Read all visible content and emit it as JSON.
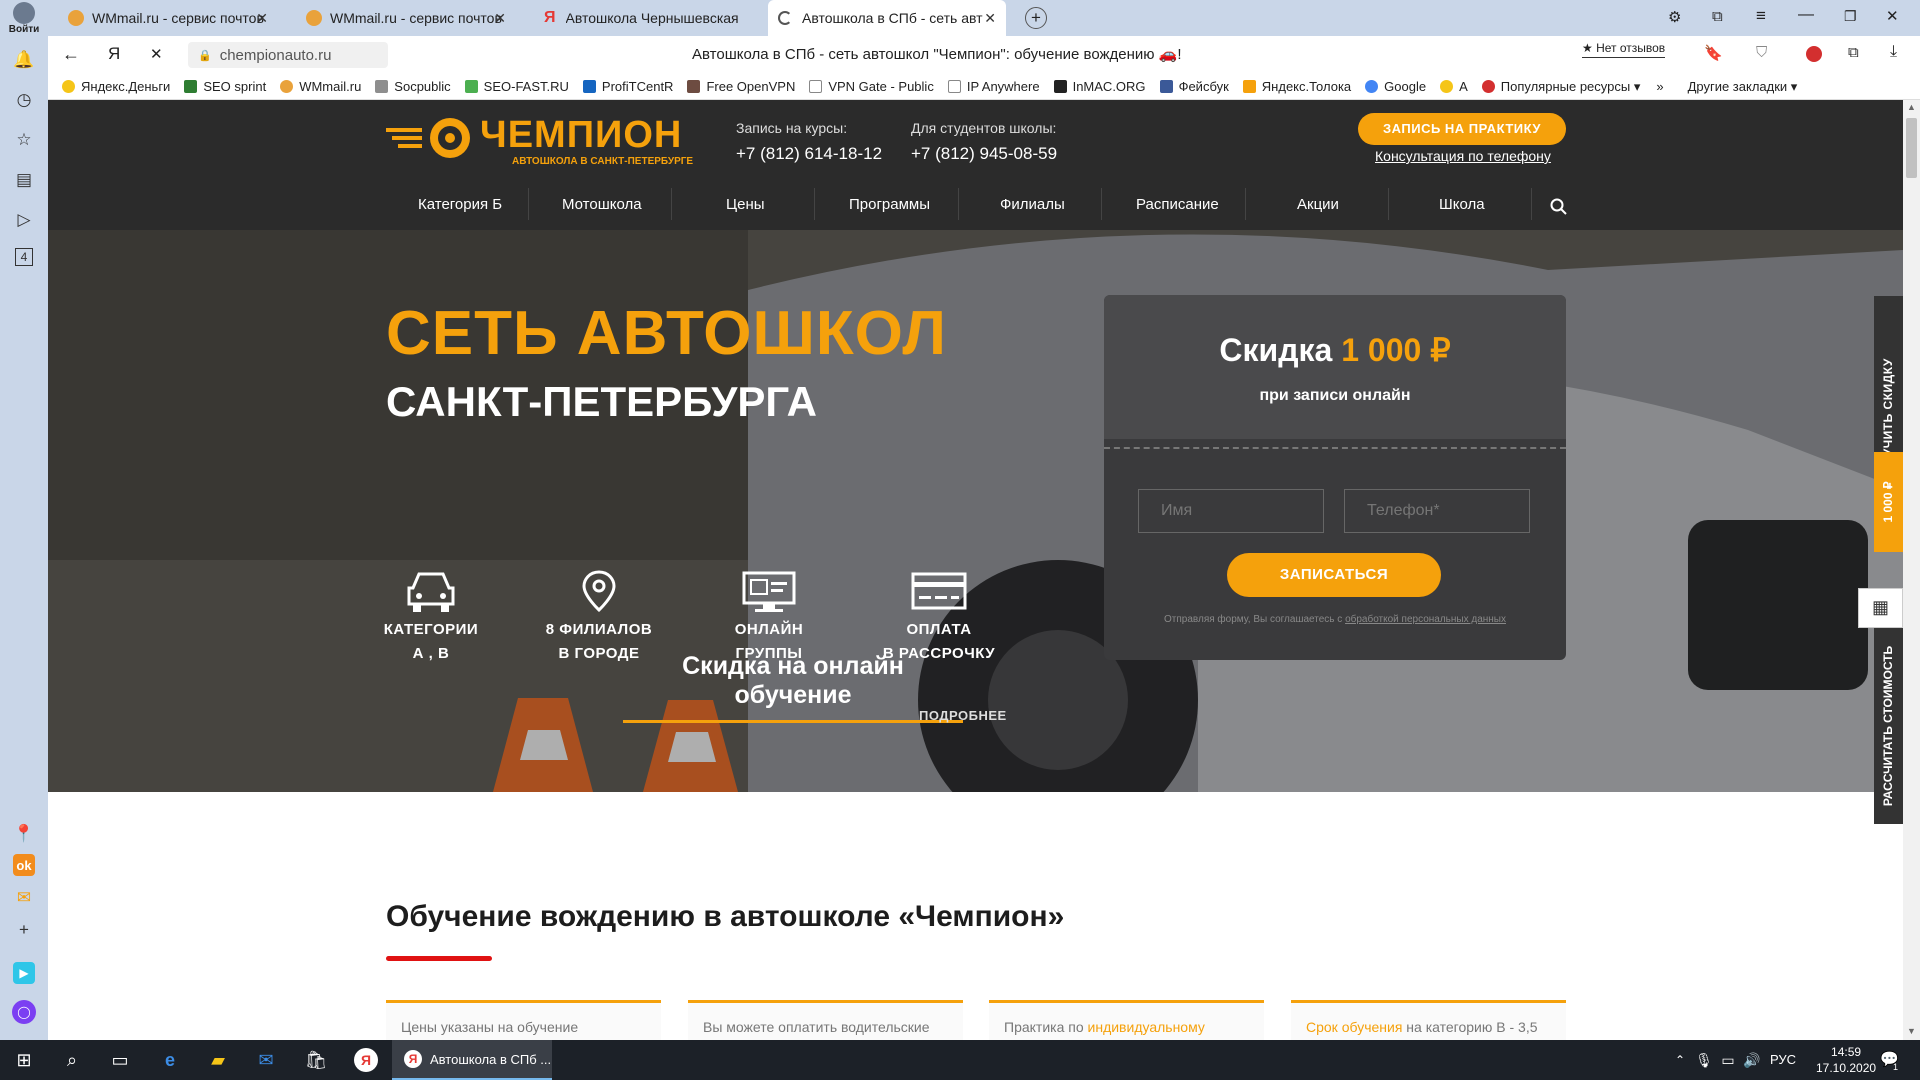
{
  "browser": {
    "tabs": [
      {
        "title": "WMmail.ru - сервис почтов",
        "color": "#e9a23b"
      },
      {
        "title": "WMmail.ru - сервис почтов",
        "color": "#e9a23b"
      },
      {
        "title": "Автошкола Чернышевская",
        "color": "#e53935"
      },
      {
        "title": "Автошкола в СПб - сеть авт",
        "color": "#555"
      }
    ],
    "login_label": "Войти",
    "url": "chempionauto.ru",
    "page_title": "Автошкола в СПб - сеть автошкол \"Чемпион\": обучение вождению 🚗!",
    "reviews_label": "★ Нет отзывов",
    "bookmarks": [
      {
        "label": "Яндекс.Деньги",
        "color": "#f5c518"
      },
      {
        "label": "SEO sprint",
        "color": "#2e7d32"
      },
      {
        "label": "WMmail.ru",
        "color": "#e9a23b"
      },
      {
        "label": "Socpublic",
        "color": "#8e8e8e"
      },
      {
        "label": "SEO-FAST.RU",
        "color": "#4caf50"
      },
      {
        "label": "ProfiTCentR",
        "color": "#1565c0"
      },
      {
        "label": "Free OpenVPN",
        "color": "#6d4c41"
      },
      {
        "label": "VPN Gate - Public",
        "color": "#9e9e9e"
      },
      {
        "label": "IP Anywhere",
        "color": "#9e9e9e"
      },
      {
        "label": "InMAC.ORG",
        "color": "#222"
      },
      {
        "label": "Фейсбук",
        "color": "#3b5998"
      },
      {
        "label": "Яндекс.Толока",
        "color": "#f5a10c"
      },
      {
        "label": "Google",
        "color": "#4285f4"
      },
      {
        "label": "A",
        "color": "#f5c518"
      },
      {
        "label": "Популярные ресурсы ▾",
        "color": "#d32f2f"
      }
    ],
    "other_bookmarks": "Другие закладки ▾"
  },
  "site": {
    "logo_name": "ЧЕМПИОН",
    "logo_sub": "АВТОШКОЛА В САНКТ-ПЕТЕРБУРГЕ",
    "contacts": [
      {
        "label": "Запись на курсы:",
        "phone": "+7 (812) 614-18-12"
      },
      {
        "label": "Для студентов школы:",
        "phone": "+7 (812) 945-08-59"
      }
    ],
    "cta_button": "ЗАПИСЬ НА ПРАКТИКУ",
    "consult_link": "Консультация по телефону",
    "nav": [
      "Категория Б",
      "Мотошкола",
      "Цены",
      "Программы",
      "Филиалы",
      "Расписание",
      "Акции",
      "Школа"
    ],
    "hero": {
      "title": "СЕТЬ АВТОШКОЛ",
      "subtitle": "САНКТ-ПЕТЕРБУРГА",
      "features": [
        {
          "line1": "КАТЕГОРИИ",
          "line2": "А , В",
          "icon": "car-icon"
        },
        {
          "line1": "8 ФИЛИАЛОВ",
          "line2": "В ГОРОДЕ",
          "icon": "map-pin-icon"
        },
        {
          "line1": "ОНЛАЙН",
          "line2": "ГРУППЫ",
          "icon": "monitor-icon"
        },
        {
          "line1": "ОПЛАТА",
          "line2": "В РАССРОЧКУ",
          "icon": "credit-card-icon"
        }
      ],
      "promo_link": "Скидка на онлайн обучение",
      "more_link": "ПОДРОБНЕЕ"
    },
    "form": {
      "discount_prefix": "Скидка",
      "discount_value": "1 000 ₽",
      "discount_note": "при записи онлайн",
      "name_placeholder": "Имя",
      "phone_placeholder": "Телефон*",
      "submit": "ЗАПИСАТЬСЯ",
      "consent_prefix": "Отправляя форму, Вы соглашаетесь с",
      "consent_link": "обработкой персональных данных"
    },
    "side_tabs": {
      "get_discount": "ПОЛУЧИТЬ СКИДКУ",
      "discount_amount": "1 000 ₽",
      "calc_cost": "РАССЧИТАТЬ СТОИМОСТЬ"
    },
    "section_title": "Обучение вождению в автошколе «Чемпион»",
    "cards": [
      {
        "pre": "Цены указаны на обучение",
        "highlight": "",
        "post": ""
      },
      {
        "pre": "Вы можете оплатить водительские",
        "highlight": "",
        "post": ""
      },
      {
        "pre": "Практика по ",
        "highlight": "индивидуальному",
        "post": ""
      },
      {
        "pre": "",
        "highlight": "Срок обучения",
        "post": " на категорию В - 3,5"
      }
    ],
    "accent_color": "#f5a10c"
  },
  "taskbar": {
    "active_window": "Автошкола в СПб ...",
    "lang": "РУС",
    "time": "14:59",
    "date": "17.10.2020",
    "notifications": "1"
  }
}
